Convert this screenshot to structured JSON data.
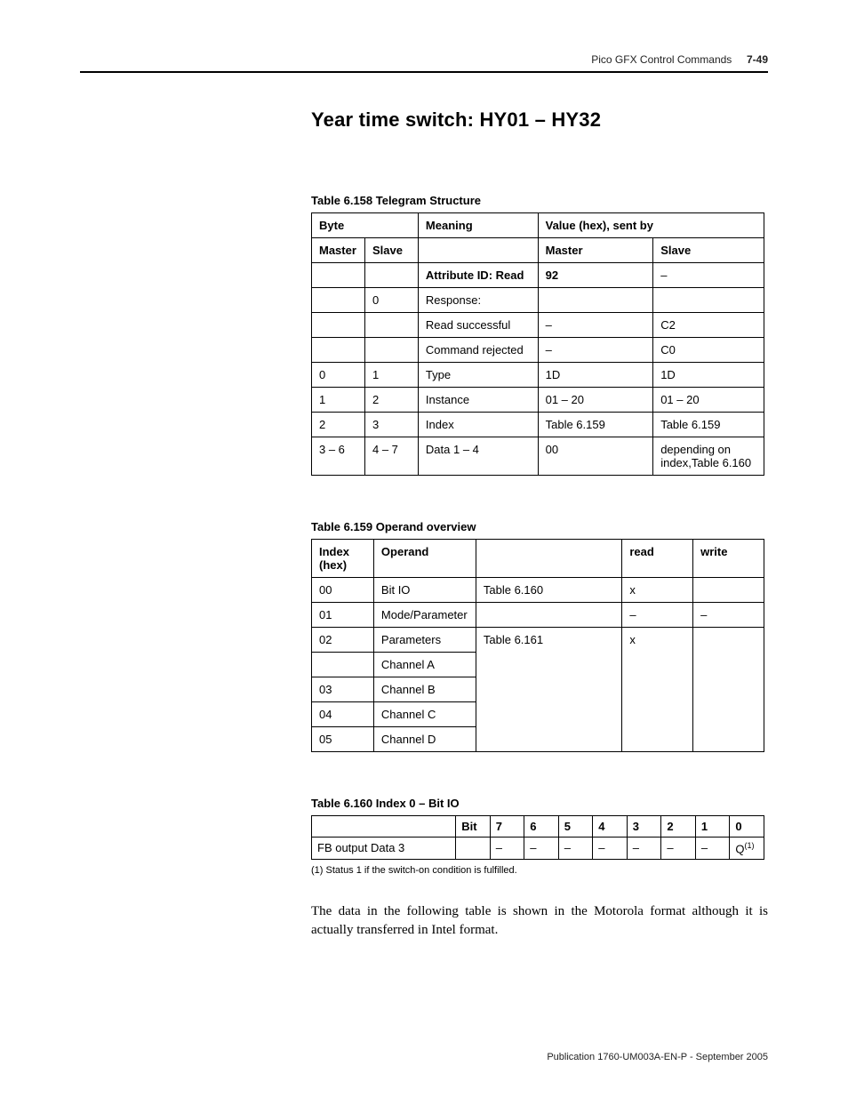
{
  "header": {
    "running_head": "Pico GFX Control Commands",
    "page_num": "7-49"
  },
  "section": {
    "title": "Year time switch: HY01 – HY32"
  },
  "table158": {
    "caption": "Table 6.158 Telegram Structure",
    "h_byte": "Byte",
    "h_meaning": "Meaning",
    "h_value": "Value (hex), sent by",
    "h_master": "Master",
    "h_slave": "Slave",
    "rows": [
      {
        "m": "",
        "s": "",
        "mean": "Attribute ID: Read",
        "vm": "92",
        "vs": "–",
        "bold_mean": true,
        "bold_vm": true
      },
      {
        "m": "",
        "s": "0",
        "mean": "Response:",
        "vm": "",
        "vs": ""
      },
      {
        "m": "",
        "s": "",
        "mean": "Read successful",
        "vm": "–",
        "vs": "C2"
      },
      {
        "m": "",
        "s": "",
        "mean": "Command rejected",
        "vm": "–",
        "vs": "C0"
      },
      {
        "m": "0",
        "s": "1",
        "mean": "Type",
        "vm": "1D",
        "vs": "1D"
      },
      {
        "m": "1",
        "s": "2",
        "mean": "Instance",
        "vm": "01 – 20",
        "vs": "01 – 20"
      },
      {
        "m": "2",
        "s": "3",
        "mean": "Index",
        "vm": "Table 6.159",
        "vs": "Table 6.159"
      },
      {
        "m": "3 – 6",
        "s": "4 – 7",
        "mean": "Data 1 – 4",
        "vm": "00",
        "vs": "depending on index,Table 6.160"
      }
    ]
  },
  "table159": {
    "caption": "Table 6.159 Operand overview",
    "h_index": "Index (hex)",
    "h_operand": "Operand",
    "h_ref": "",
    "h_read": "read",
    "h_write": "write",
    "rows": [
      {
        "idx": "00",
        "op": "Bit IO",
        "ref": "Table 6.160",
        "r": "x",
        "w": ""
      },
      {
        "idx": "01",
        "op": "Mode/Parameter",
        "ref": "",
        "r": "–",
        "w": "–"
      },
      {
        "idx": "02",
        "op": "Parameters",
        "ref": "Table 6.161",
        "r": "x",
        "w": "",
        "group_start": true
      },
      {
        "idx": "",
        "op": "Channel A",
        "ref": "",
        "r": "",
        "w": "",
        "group_cont": true
      },
      {
        "idx": "03",
        "op": "Channel B",
        "ref": "",
        "r": "",
        "w": "",
        "group_cont": true
      },
      {
        "idx": "04",
        "op": "Channel C",
        "ref": "",
        "r": "",
        "w": "",
        "group_cont": true
      },
      {
        "idx": "05",
        "op": "Channel D",
        "ref": "",
        "r": "",
        "w": "",
        "group_cont": true
      }
    ]
  },
  "table160": {
    "caption": "Table 6.160 Index 0 – Bit IO",
    "h_bit": "Bit",
    "bits": [
      "7",
      "6",
      "5",
      "4",
      "3",
      "2",
      "1",
      "0"
    ],
    "row_label": "FB output Data 3",
    "row_cells": [
      "–",
      "–",
      "–",
      "–",
      "–",
      "–",
      "–",
      "Q"
    ],
    "q_sup": "(1)"
  },
  "footnote": "(1)   Status 1 if the switch-on condition is fulfilled.",
  "para1": "The data in the following table is shown in the Motorola format although it is actually transferred in Intel format.",
  "footer": "Publication 1760-UM003A-EN-P - September 2005"
}
